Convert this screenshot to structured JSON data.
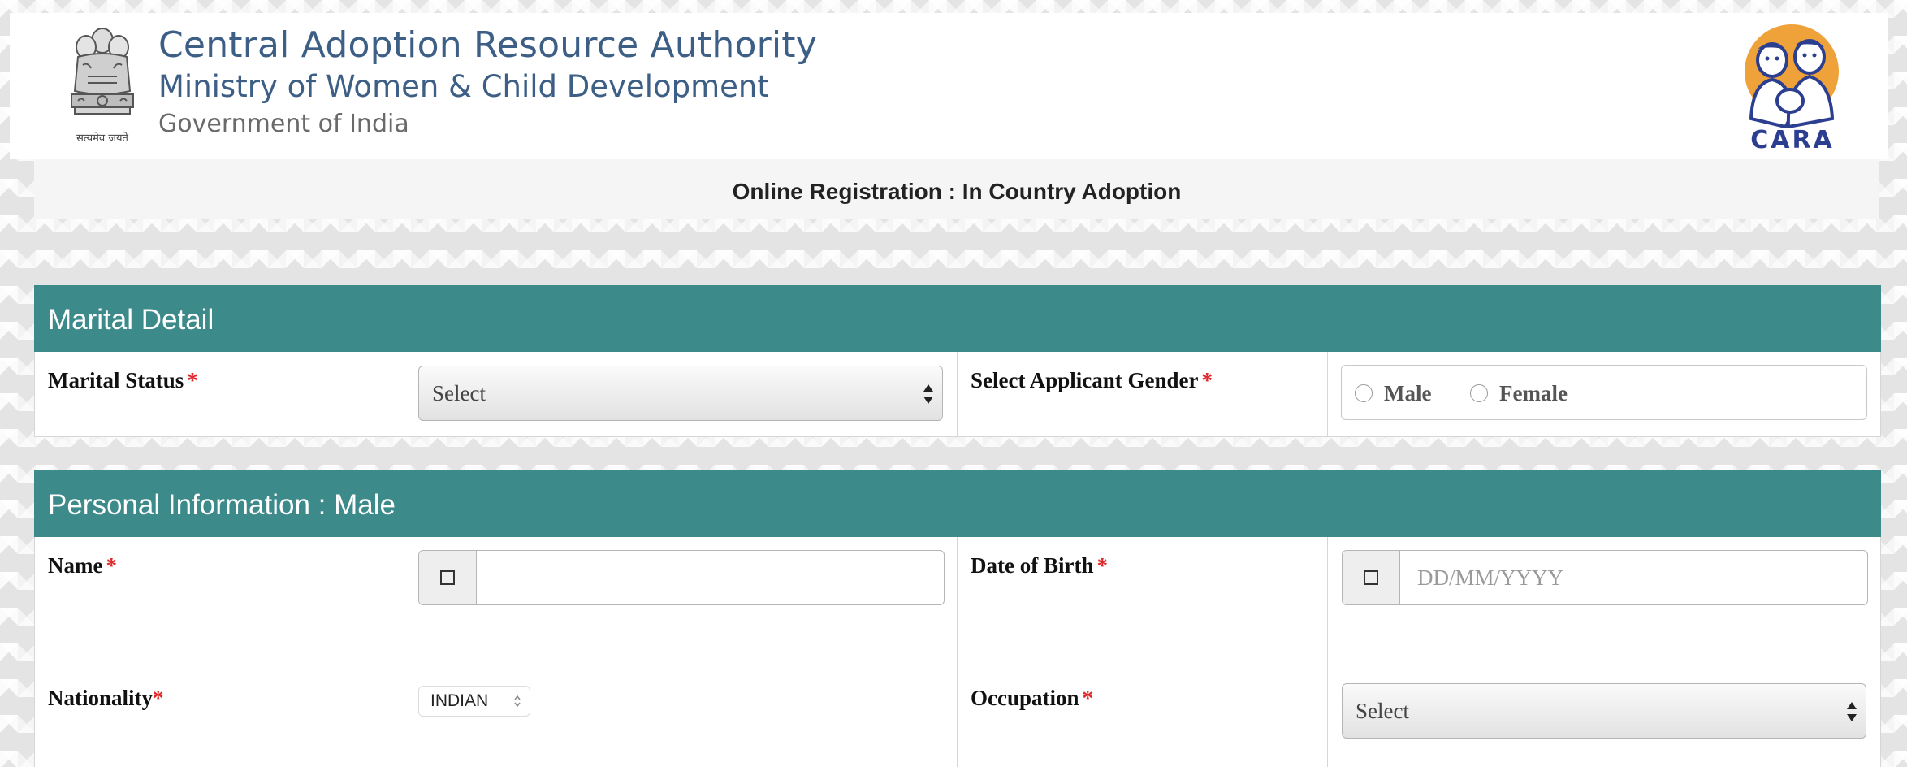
{
  "header": {
    "title": "Central Adoption Resource Authority",
    "ministry": "Ministry of Women & Child Development",
    "government": "Government of India",
    "emblem_icon": "national-emblem-icon",
    "logo_text": "CARA",
    "logo_icon": "cara-mother-child-logo-icon",
    "emblem_motto": "सत्यमेव जयते"
  },
  "page_title": "Online Registration : In Country Adoption",
  "marital_section": {
    "title": "Marital Detail",
    "marital_status_label": "Marital Status",
    "marital_status_value": "Select",
    "gender_label": "Select Applicant Gender",
    "gender_options": [
      "Male",
      "Female"
    ]
  },
  "personal_section": {
    "title": "Personal Information : Male",
    "name_label": "Name",
    "name_value": "",
    "dob_label": "Date of Birth",
    "dob_placeholder": "DD/MM/YYYY",
    "nationality_label": "Nationality",
    "nationality_value": "INDIAN",
    "occupation_label": "Occupation",
    "occupation_value": "Select"
  },
  "required_marker": "*",
  "colors": {
    "section_header": "#3d8a8b",
    "title_blue": "#3d5f86",
    "required": "#e0272b",
    "logo_orange": "#f0a23a",
    "logo_blue": "#2c3e8f"
  }
}
